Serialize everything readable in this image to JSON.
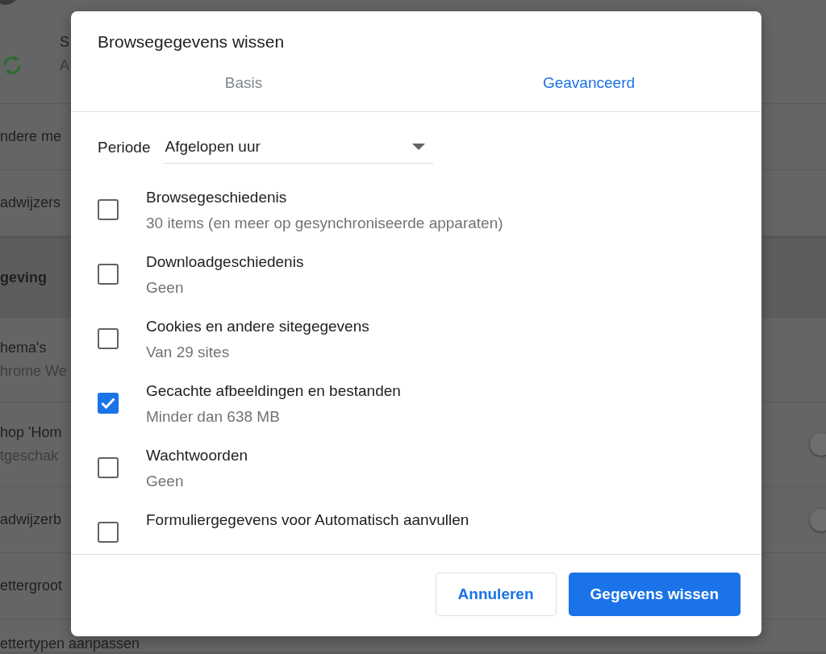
{
  "background": {
    "rows": [
      {
        "kind": "account",
        "texts": [
          "S",
          "A"
        ]
      },
      {
        "kind": "plain",
        "texts": [
          "ndere me"
        ]
      },
      {
        "kind": "plain",
        "texts": [
          "adwijzers"
        ]
      },
      {
        "kind": "heading",
        "texts": [
          "geving"
        ]
      },
      {
        "kind": "plain",
        "texts": [
          "hema's",
          "hrome We"
        ]
      },
      {
        "kind": "toggle",
        "texts": [
          "hop 'Hom",
          "tgeschak"
        ],
        "on": false
      },
      {
        "kind": "toggle",
        "texts": [
          "adwijzerb"
        ],
        "on": false
      },
      {
        "kind": "select",
        "texts": [
          "ettergroot"
        ]
      },
      {
        "kind": "plain",
        "texts": [
          "ettertypen aanpassen"
        ]
      }
    ]
  },
  "dialog": {
    "title": "Browsegegevens wissen",
    "tabs": [
      {
        "label": "Basis",
        "selected": false
      },
      {
        "label": "Geavanceerd",
        "selected": true
      }
    ],
    "period": {
      "label": "Periode",
      "value": "Afgelopen uur"
    },
    "items": [
      {
        "label": "Browsegeschiedenis",
        "detail": "30 items (en meer op gesynchroniseerde apparaten)",
        "checked": false
      },
      {
        "label": "Downloadgeschiedenis",
        "detail": "Geen",
        "checked": false
      },
      {
        "label": "Cookies en andere sitegegevens",
        "detail": "Van 29 sites",
        "checked": false
      },
      {
        "label": "Gecachte afbeeldingen en bestanden",
        "detail": "Minder dan 638 MB",
        "checked": true
      },
      {
        "label": "Wachtwoorden",
        "detail": "Geen",
        "checked": false
      },
      {
        "label": "Formuliergegevens voor Automatisch aanvullen",
        "checked": false
      }
    ],
    "buttons": [
      {
        "label": "Annuleren",
        "kind": "secondary"
      },
      {
        "label": "Gegevens wissen",
        "kind": "primary"
      }
    ]
  }
}
